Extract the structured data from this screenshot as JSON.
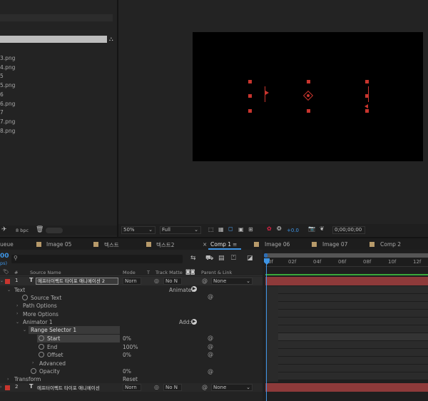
{
  "project": {
    "files": [
      "3.png",
      "4.png",
      "5",
      "5.png",
      "6",
      "6.png",
      "7",
      "7.png",
      "8.png"
    ],
    "bpc": "8 bpc"
  },
  "viewer": {
    "zoom": "50%",
    "resolution": "Full",
    "exposure": "+0.0",
    "timecode": "0;00;00;00"
  },
  "tabs": {
    "queue": "ueue",
    "image05": "Image 05",
    "text1": "텍스트",
    "text2": "텍스트2",
    "comp1": "Comp 1",
    "image06": "Image 06",
    "image07": "Image 07",
    "comp2": "Comp 2"
  },
  "timeline": {
    "time_left": "00",
    "fps_left": "ps)",
    "search_placeholder": "",
    "headers": {
      "num": "#",
      "source": "Source Name",
      "mode": "Mode",
      "t": "T",
      "matte": "Track Matte",
      "parent": "Parent & Link"
    },
    "ruler": [
      "0f",
      "02f",
      "04f",
      "06f",
      "08f",
      "10f",
      "12f"
    ],
    "layer1": {
      "num": "1",
      "name": "에프터이펙트 타이포 애니메이션 2",
      "mode": "Norn",
      "matte": "No N",
      "parent": "None"
    },
    "layer2": {
      "num": "2",
      "name": "에프터이펙트 타이포 애니메이션",
      "mode": "Norn",
      "matte": "No N",
      "parent": "None"
    },
    "props": {
      "text": "Text",
      "animate_label": "Animate:",
      "source_text": "Source Text",
      "path_options": "Path Options",
      "more_options": "More Options",
      "animator": "Animator 1",
      "add_label": "Add:",
      "range_selector": "Range Selector 1",
      "start": "Start",
      "start_val": "0",
      "end": "End",
      "end_val": "100",
      "offset": "Offset",
      "offset_val": "0",
      "advanced": "Advanced",
      "opacity": "Opacity",
      "opacity_val": "0",
      "transform": "Transform",
      "reset": "Reset",
      "percent": "%"
    }
  },
  "colors": {
    "label_red": "#c8352e",
    "accent_blue": "#3e95e6",
    "work_area": "#2e6db3",
    "layer_bar": "#8e3a3a"
  }
}
